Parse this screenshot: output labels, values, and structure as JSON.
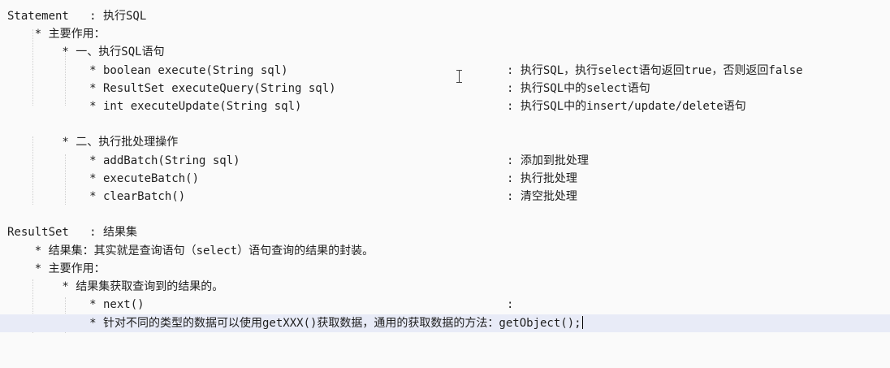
{
  "lines": [
    {
      "left": "Statement   : 执行SQL",
      "right": ""
    },
    {
      "left": "    * 主要作用：",
      "right": ""
    },
    {
      "left": "        * 一、执行SQL语句",
      "right": ""
    },
    {
      "left": "            * boolean execute(String sql)",
      "right": ": 执行SQL，执行select语句返回true，否则返回false"
    },
    {
      "left": "            * ResultSet executeQuery(String sql)",
      "right": ": 执行SQL中的select语句"
    },
    {
      "left": "            * int executeUpdate(String sql)",
      "right": ": 执行SQL中的insert/update/delete语句"
    },
    {
      "left": "",
      "right": ""
    },
    {
      "left": "        * 二、执行批处理操作",
      "right": ""
    },
    {
      "left": "            * addBatch(String sql)",
      "right": ": 添加到批处理"
    },
    {
      "left": "            * executeBatch()",
      "right": ": 执行批处理"
    },
    {
      "left": "            * clearBatch()",
      "right": ": 清空批处理"
    },
    {
      "left": "",
      "right": ""
    },
    {
      "left": "ResultSet   : 结果集",
      "right": ""
    },
    {
      "left": "    * 结果集：其实就是查询语句（select）语句查询的结果的封装。",
      "right": ""
    },
    {
      "left": "    * 主要作用：",
      "right": ""
    },
    {
      "left": "        * 结果集获取查询到的结果的。",
      "right": ""
    },
    {
      "left": "            * next()",
      "right": ":"
    },
    {
      "left": "            * 针对不同的类型的数据可以使用getXXX()获取数据，通用的获取数据的方法：getObject();",
      "right": ""
    }
  ]
}
